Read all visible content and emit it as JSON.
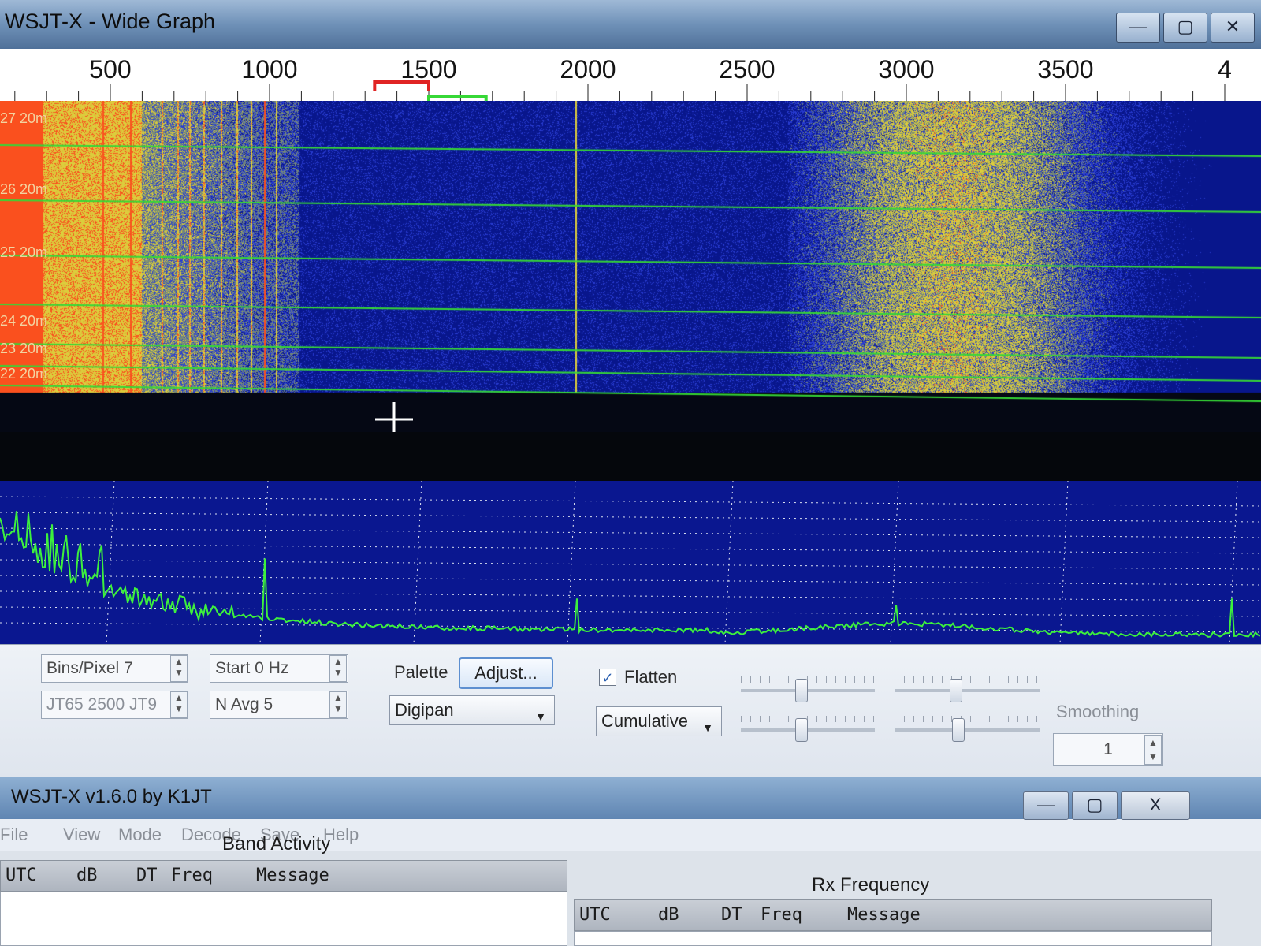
{
  "wide_graph": {
    "title": "WSJT-X - Wide Graph",
    "window_buttons": [
      "—",
      "▢",
      "✕"
    ],
    "freq_axis": [
      {
        "label": "500",
        "hz": 500
      },
      {
        "label": "1000",
        "hz": 1000
      },
      {
        "label": "1500",
        "hz": 1500
      },
      {
        "label": "2000",
        "hz": 2000
      },
      {
        "label": "2500",
        "hz": 2500
      },
      {
        "label": "3000",
        "hz": 3000
      },
      {
        "label": "3500",
        "hz": 3500
      },
      {
        "label": "4",
        "hz": 4000
      }
    ],
    "rx_marker_hz": [
      1330,
      1500
    ],
    "tx_marker_hz": [
      1500,
      1680
    ],
    "waterfall_rows": [
      "27 20m",
      "26 20m",
      "25 20m",
      "24 20m",
      "23 20m",
      "22 20m"
    ],
    "controls": {
      "bins_per_pixel": "Bins/Pixel  7",
      "start_hz": "Start 0 Hz",
      "jt_mode": "JT65  2500  JT9",
      "n_avg": "N Avg 5",
      "palette_label": "Palette",
      "adjust_button": "Adjust...",
      "palette_value": "Digipan",
      "flatten_label": "Flatten",
      "flatten_checked": true,
      "spectrum_mode": "Cumulative",
      "smoothing_label": "Smoothing",
      "smoothing_value": "1",
      "slider_levels": [
        0.45,
        0.42,
        0.45,
        0.44
      ]
    }
  },
  "main_window": {
    "title": "WSJT-X   v1.6.0    by K1JT",
    "window_buttons": [
      "—",
      "▢",
      "X"
    ],
    "menu": [
      "File",
      "View",
      "Mode",
      "Decode",
      "Save",
      "Help"
    ],
    "band_activity": {
      "title": "Band Activity",
      "columns": [
        "UTC",
        "dB",
        "DT",
        "Freq",
        "Message"
      ]
    },
    "rx_frequency": {
      "title": "Rx Frequency",
      "columns": [
        "UTC",
        "dB",
        "DT",
        "Freq",
        "Message"
      ]
    }
  },
  "colors": {
    "waterfall_bg": "#0a1aa0",
    "signal_yellow": "#e6d23a",
    "signal_red": "#ff4a1a",
    "spectrum_line": "#3df03d",
    "green_marker": "#36d836",
    "red_marker": "#e02424"
  }
}
